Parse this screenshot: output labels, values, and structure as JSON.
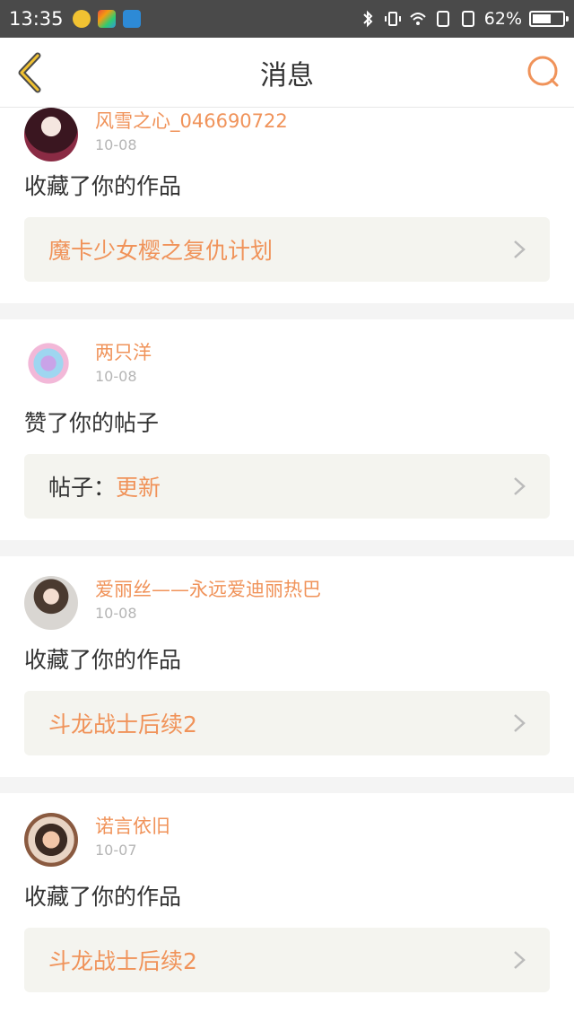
{
  "status_bar": {
    "time": "13:35",
    "battery": "62%",
    "battery_level": 0.62
  },
  "header": {
    "title": "消息",
    "back_icon": "chevron-left-icon",
    "search_icon": "search-icon",
    "accent": "#f0935a"
  },
  "messages": [
    {
      "user": "风雪之心_046690722",
      "date": "10-08",
      "action": "收藏了你的作品",
      "target_prefix": "",
      "target": "魔卡少女樱之复仇计划"
    },
    {
      "user": "两只洋",
      "date": "10-08",
      "action": "赞了你的帖子",
      "target_prefix": "帖子：",
      "target": "更新"
    },
    {
      "user": "爱丽丝——永远爱迪丽热巴",
      "date": "10-08",
      "action": "收藏了你的作品",
      "target_prefix": "",
      "target": "斗龙战士后续2"
    },
    {
      "user": "诺言依旧",
      "date": "10-07",
      "action": "收藏了你的作品",
      "target_prefix": "",
      "target": "斗龙战士后续2"
    }
  ]
}
